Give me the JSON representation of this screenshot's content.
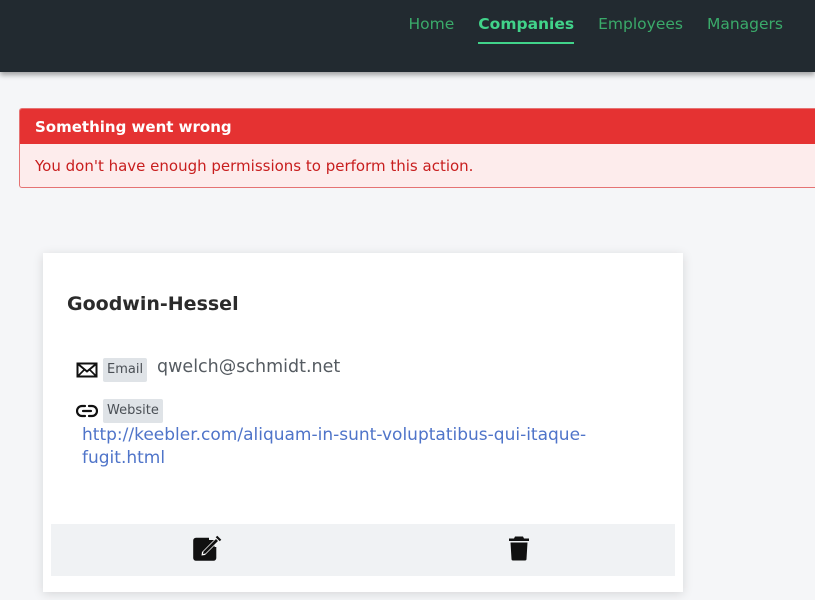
{
  "nav": {
    "items": [
      {
        "label": "Home",
        "active": false
      },
      {
        "label": "Companies",
        "active": true
      },
      {
        "label": "Employees",
        "active": false
      },
      {
        "label": "Managers",
        "active": false
      }
    ]
  },
  "alert": {
    "title": "Something went wrong",
    "message": "You don't have enough permissions to perform this action."
  },
  "company": {
    "name": "Goodwin-Hessel",
    "email_label": "Email",
    "email": "qwelch@schmidt.net",
    "website_label": "Website",
    "website": "http://keebler.com/aliquam-in-sunt-voluptatibus-qui-itaque-fugit.html",
    "website_line1": "http://keebler.com/aliquam-in-sunt-voluptatibus-qui-itaque-",
    "website_line2": "fugit.html"
  },
  "icons": {
    "email": "envelope-icon",
    "website": "link-icon",
    "edit": "edit-icon",
    "delete": "trash-icon"
  },
  "colors": {
    "navbar": "#222a30",
    "nav_link": "#3aaa6a",
    "nav_active": "#41d38a",
    "alert_header": "#e53232",
    "alert_body_bg": "#fdecec",
    "alert_text": "#c81e1e",
    "link": "#4f74c9"
  }
}
